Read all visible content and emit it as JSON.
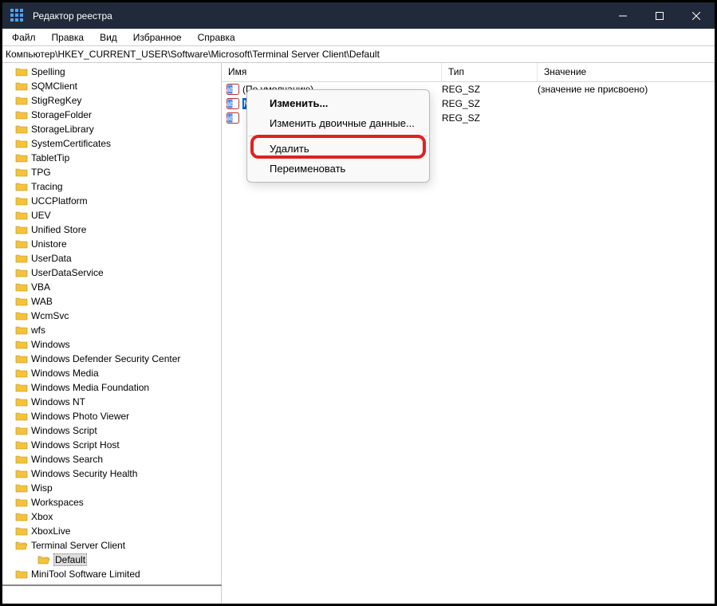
{
  "window": {
    "title": "Редактор реестра"
  },
  "menu": {
    "file": "Файл",
    "edit": "Правка",
    "view": "Вид",
    "favorites": "Избранное",
    "help": "Справка"
  },
  "path": "Компьютер\\HKEY_CURRENT_USER\\Software\\Microsoft\\Terminal Server Client\\Default",
  "columns": {
    "name": "Имя",
    "type": "Тип",
    "value": "Значение"
  },
  "values": [
    {
      "name": "(По умолчанию)",
      "type": "REG_SZ",
      "data": "(значение не присвоено)",
      "selected": false
    },
    {
      "name": "MRU0",
      "type": "REG_SZ",
      "data": "",
      "selected": true
    },
    {
      "name": "",
      "type": "REG_SZ",
      "data": "",
      "selected": false
    }
  ],
  "tree": [
    {
      "label": "Spelling",
      "indent": false,
      "selected": false
    },
    {
      "label": "SQMClient",
      "indent": false,
      "selected": false
    },
    {
      "label": "StigRegKey",
      "indent": false,
      "selected": false
    },
    {
      "label": "StorageFolder",
      "indent": false,
      "selected": false
    },
    {
      "label": "StorageLibrary",
      "indent": false,
      "selected": false
    },
    {
      "label": "SystemCertificates",
      "indent": false,
      "selected": false
    },
    {
      "label": "TabletTip",
      "indent": false,
      "selected": false
    },
    {
      "label": "TPG",
      "indent": false,
      "selected": false
    },
    {
      "label": "Tracing",
      "indent": false,
      "selected": false
    },
    {
      "label": "UCCPlatform",
      "indent": false,
      "selected": false
    },
    {
      "label": "UEV",
      "indent": false,
      "selected": false
    },
    {
      "label": "Unified Store",
      "indent": false,
      "selected": false
    },
    {
      "label": "Unistore",
      "indent": false,
      "selected": false
    },
    {
      "label": "UserData",
      "indent": false,
      "selected": false
    },
    {
      "label": "UserDataService",
      "indent": false,
      "selected": false
    },
    {
      "label": "VBA",
      "indent": false,
      "selected": false
    },
    {
      "label": "WAB",
      "indent": false,
      "selected": false
    },
    {
      "label": "WcmSvc",
      "indent": false,
      "selected": false
    },
    {
      "label": "wfs",
      "indent": false,
      "selected": false
    },
    {
      "label": "Windows",
      "indent": false,
      "selected": false
    },
    {
      "label": "Windows Defender Security Center",
      "indent": false,
      "selected": false
    },
    {
      "label": "Windows Media",
      "indent": false,
      "selected": false
    },
    {
      "label": "Windows Media Foundation",
      "indent": false,
      "selected": false
    },
    {
      "label": "Windows NT",
      "indent": false,
      "selected": false
    },
    {
      "label": "Windows Photo Viewer",
      "indent": false,
      "selected": false
    },
    {
      "label": "Windows Script",
      "indent": false,
      "selected": false
    },
    {
      "label": "Windows Script Host",
      "indent": false,
      "selected": false
    },
    {
      "label": "Windows Search",
      "indent": false,
      "selected": false
    },
    {
      "label": "Windows Security Health",
      "indent": false,
      "selected": false
    },
    {
      "label": "Wisp",
      "indent": false,
      "selected": false
    },
    {
      "label": "Workspaces",
      "indent": false,
      "selected": false
    },
    {
      "label": "Xbox",
      "indent": false,
      "selected": false
    },
    {
      "label": "XboxLive",
      "indent": false,
      "selected": false
    },
    {
      "label": "Terminal Server Client",
      "indent": false,
      "selected": false,
      "open": true
    },
    {
      "label": "Default",
      "indent": true,
      "selected": true,
      "open": true
    },
    {
      "label": "MiniTool Software Limited",
      "indent": false,
      "selected": false
    }
  ],
  "context_menu": {
    "modify": "Изменить...",
    "modify_binary": "Изменить двоичные данные...",
    "delete": "Удалить",
    "rename": "Переименовать"
  }
}
